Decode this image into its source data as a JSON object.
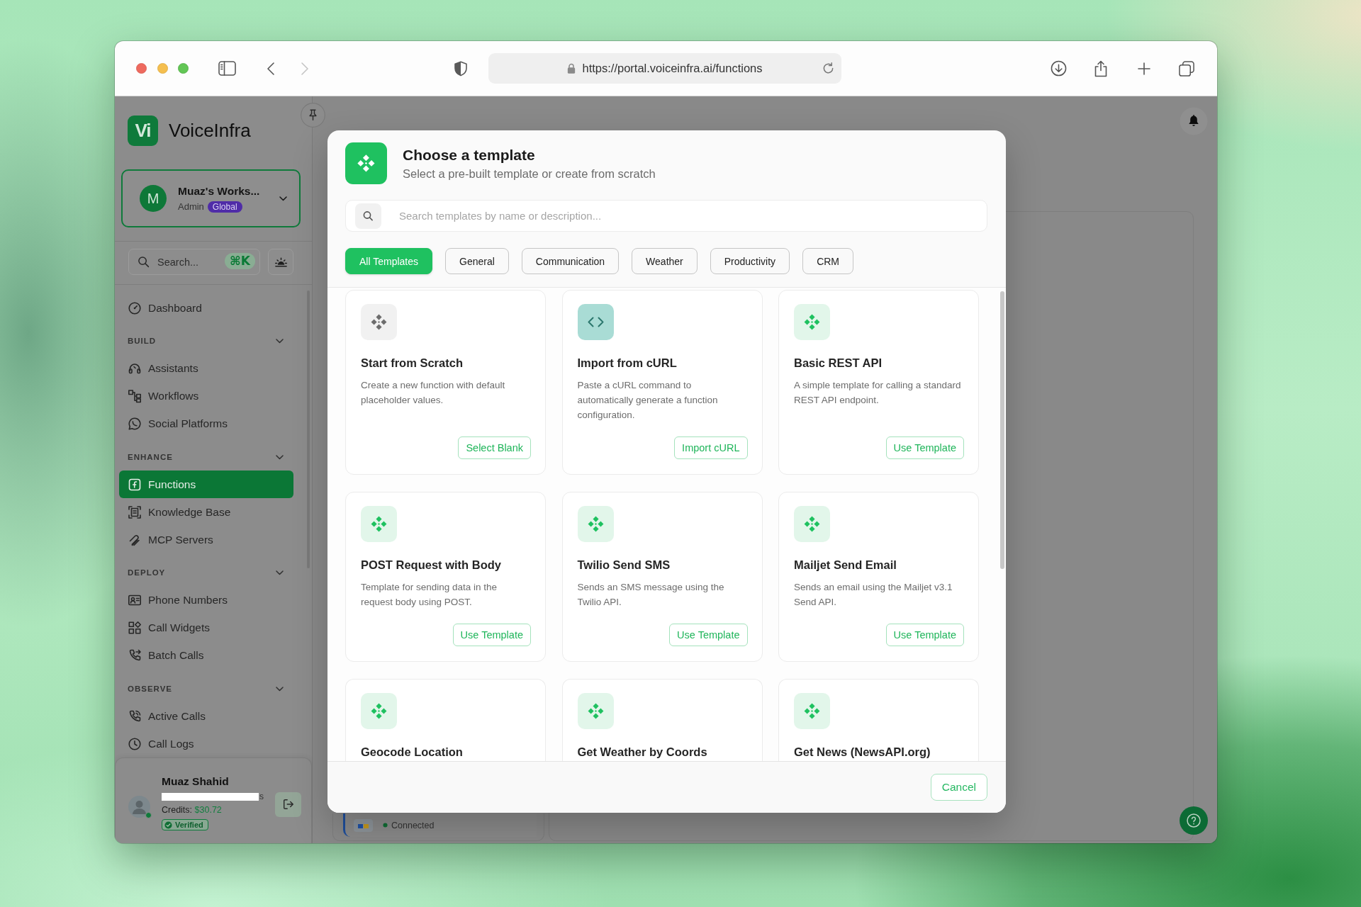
{
  "browser": {
    "url": "https://portal.voiceinfra.ai/functions",
    "nav_buttons": [
      {
        "kind": "back",
        "disabled": false
      },
      {
        "kind": "forward",
        "disabled": true
      }
    ]
  },
  "sidebar": {
    "logo": "Vi",
    "brand": "VoiceInfra",
    "workspace": {
      "avatar": "M",
      "name": "Muaz's Works...",
      "role": "Admin",
      "badge": "Global"
    },
    "search": {
      "placeholder": "Search...",
      "shortcut": "⌘K"
    },
    "nav": [
      {
        "items": [
          {
            "label": "Dashboard",
            "selected": false
          }
        ]
      },
      {
        "heading": "BUILD",
        "expanded": true,
        "items": [
          {
            "label": "Assistants",
            "selected": false
          },
          {
            "label": "Workflows",
            "selected": false
          },
          {
            "label": "Social Platforms",
            "selected": false
          }
        ]
      },
      {
        "heading": "ENHANCE",
        "expanded": true,
        "items": [
          {
            "label": "Functions",
            "selected": true
          },
          {
            "label": "Knowledge Base",
            "selected": false
          },
          {
            "label": "MCP Servers",
            "selected": false
          }
        ]
      },
      {
        "heading": "DEPLOY",
        "expanded": true,
        "items": [
          {
            "label": "Phone Numbers",
            "selected": false
          },
          {
            "label": "Call Widgets",
            "selected": false
          },
          {
            "label": "Batch Calls",
            "selected": false
          }
        ]
      },
      {
        "heading": "OBSERVE",
        "expanded": true,
        "items": [
          {
            "label": "Active Calls",
            "selected": false
          },
          {
            "label": "Call Logs",
            "selected": false
          }
        ]
      }
    ],
    "user": {
      "name": "Muaz Shahid",
      "online": true,
      "email": "s",
      "credits": {
        "label": "Credits:",
        "amount": "$30.72"
      },
      "badge": "Verified"
    }
  },
  "main": {
    "integration": {
      "status": "Connected"
    }
  },
  "modal": {
    "title": "Choose a template",
    "subtitle": "Select a pre-built template or create from scratch",
    "search": {
      "placeholder": "Search templates by name or description..."
    },
    "filters": [
      {
        "label": "All Templates",
        "selected": true
      },
      {
        "label": "General",
        "selected": false
      },
      {
        "label": "Communication",
        "selected": false
      },
      {
        "label": "Weather",
        "selected": false
      },
      {
        "label": "Productivity",
        "selected": false
      },
      {
        "label": "CRM",
        "selected": false
      }
    ],
    "templates": [
      {
        "kind": "blank",
        "title": "Start from Scratch",
        "description": "Create a new function with default placeholder values.",
        "action": "Select Blank"
      },
      {
        "kind": "curl",
        "title": "Import from cURL",
        "description": "Paste a cURL command to automatically generate a function configuration.",
        "action": "Import cURL"
      },
      {
        "kind": "template",
        "title": "Basic REST API",
        "description": "A simple template for calling a standard REST API endpoint.",
        "action": "Use Template"
      },
      {
        "kind": "template",
        "title": "POST Request with Body",
        "description": "Template for sending data in the request body using POST.",
        "action": "Use Template"
      },
      {
        "kind": "template",
        "title": "Twilio Send SMS",
        "description": "Sends an SMS message using the Twilio API.",
        "action": "Use Template"
      },
      {
        "kind": "template",
        "title": "Mailjet Send Email",
        "description": "Sends an email using the Mailjet v3.1 Send API.",
        "action": "Use Template"
      },
      {
        "kind": "template",
        "title": "Geocode Location"
      },
      {
        "kind": "template",
        "title": "Get Weather by Coords"
      },
      {
        "kind": "template",
        "title": "Get News (NewsAPI.org)"
      }
    ],
    "cancel": "Cancel"
  }
}
